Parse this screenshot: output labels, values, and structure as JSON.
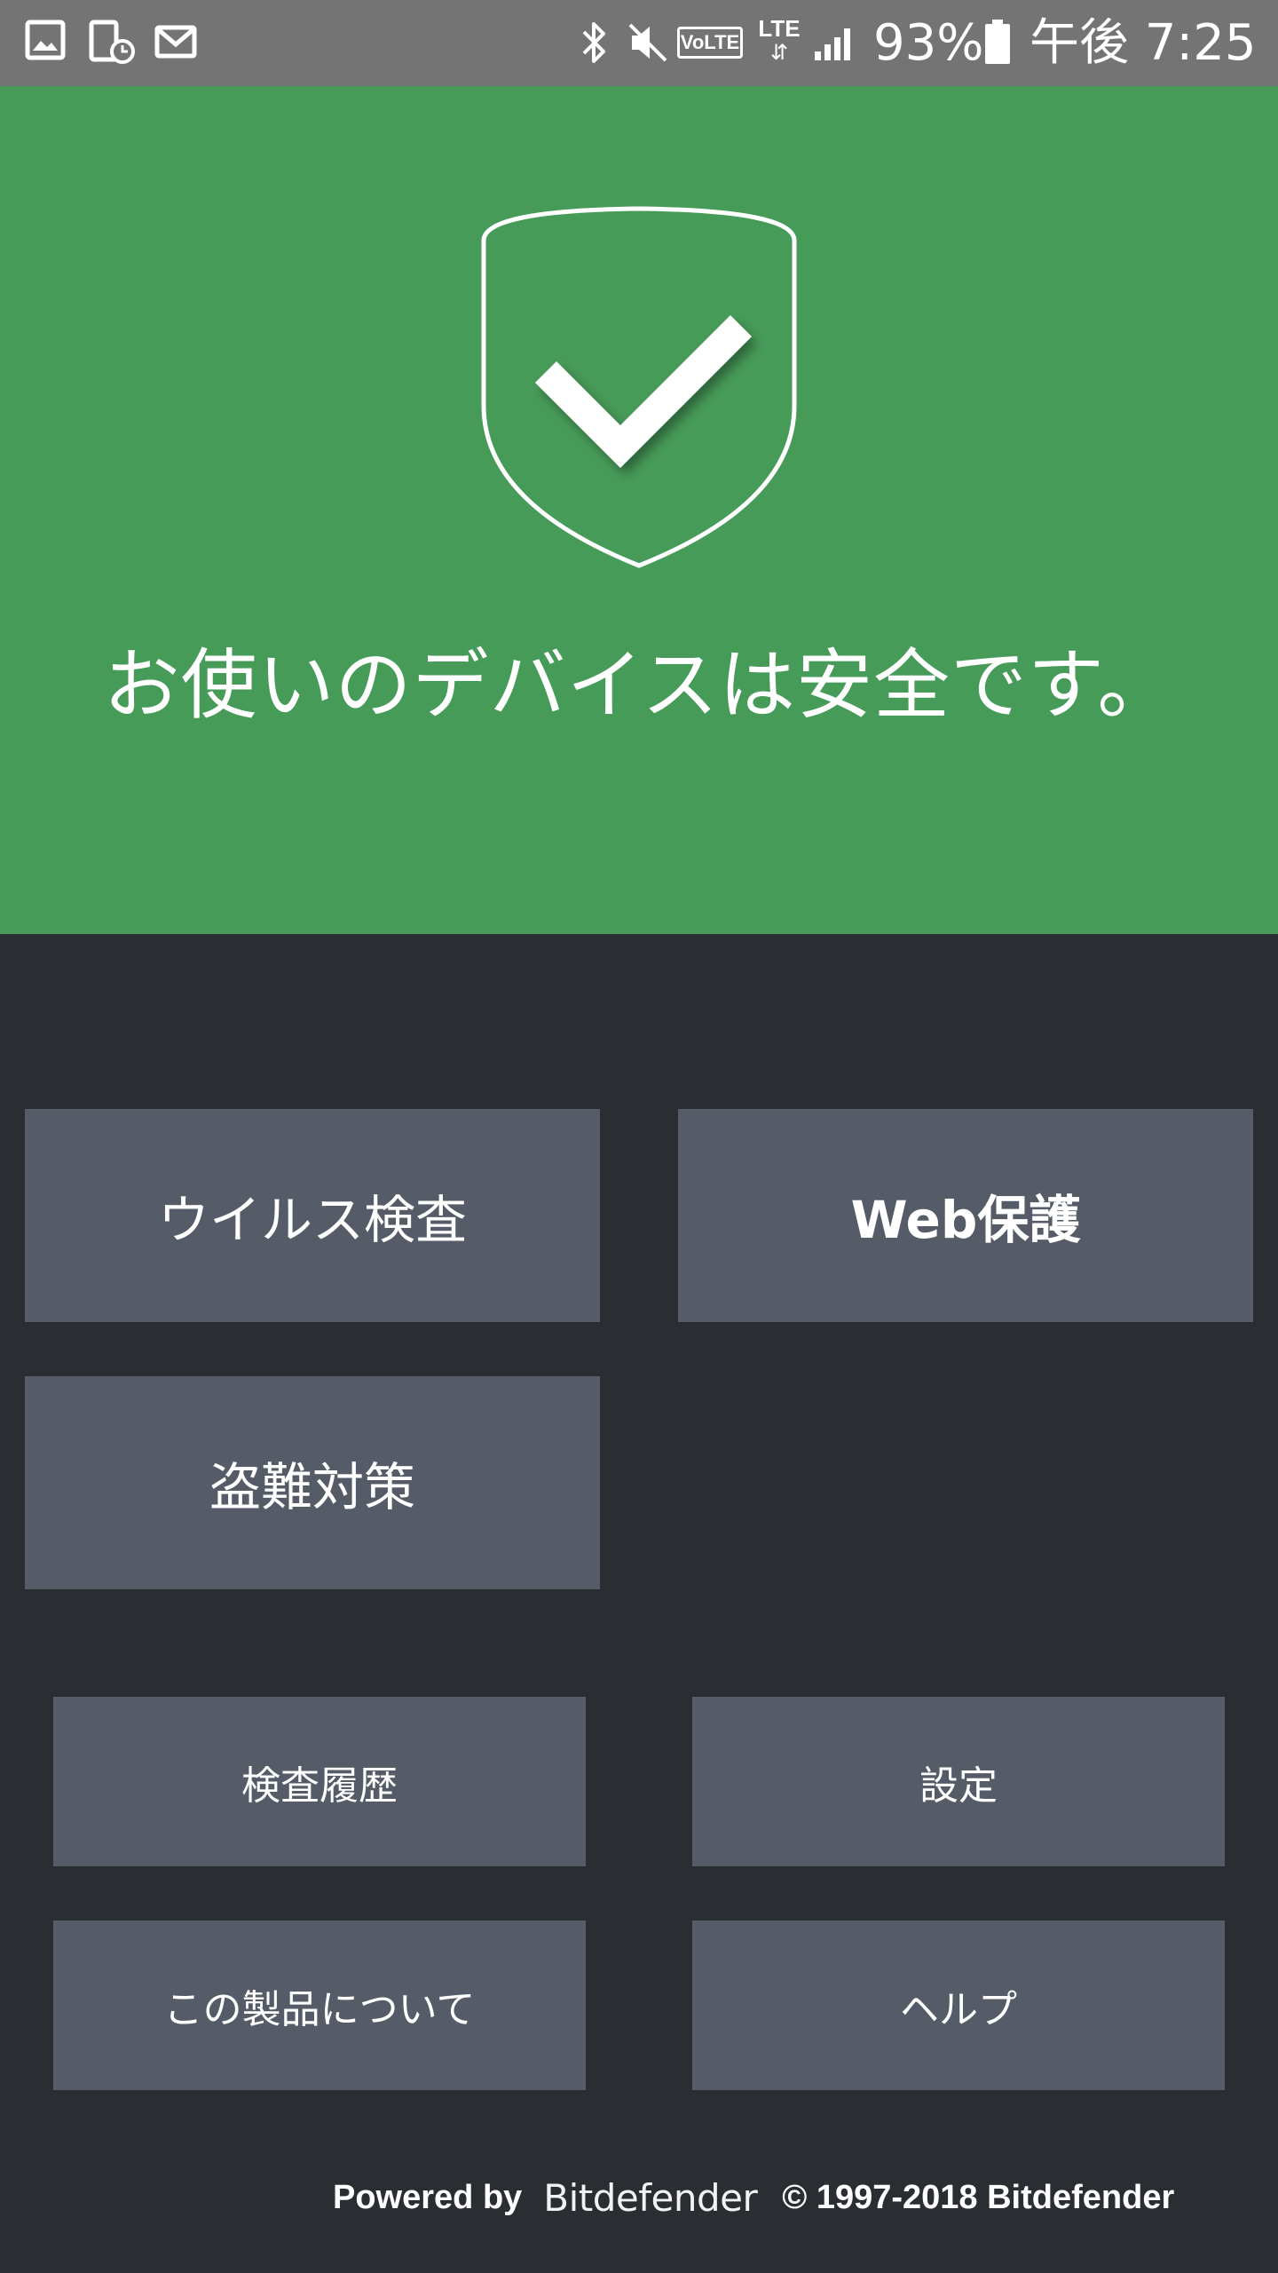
{
  "status_bar": {
    "icons_left": [
      "gallery-icon",
      "screenshot-icon",
      "mail-icon"
    ],
    "icons_right": [
      "bluetooth-icon",
      "mute-icon",
      "volte-icon",
      "lte-icon",
      "signal-icon",
      "battery-icon"
    ],
    "volte": "VoLTE",
    "lte": "LTE",
    "battery_percent": "93%",
    "time": "午後 7:25"
  },
  "hero": {
    "status_icon": "shield-check-icon",
    "title": "お使いのデバイスは安全です。",
    "background": "#479b59"
  },
  "features": {
    "virus_scan": "ウイルス検査",
    "web_protection": "Web保護",
    "anti_theft": "盗難対策"
  },
  "menu": {
    "scan_history": "検査履歴",
    "settings": "設定",
    "about": "この製品について",
    "help": "ヘルプ"
  },
  "footer": {
    "powered_by": "Powered by",
    "brand": "Bitdefender",
    "copyright": "© 1997-2018 Bitdefender"
  }
}
